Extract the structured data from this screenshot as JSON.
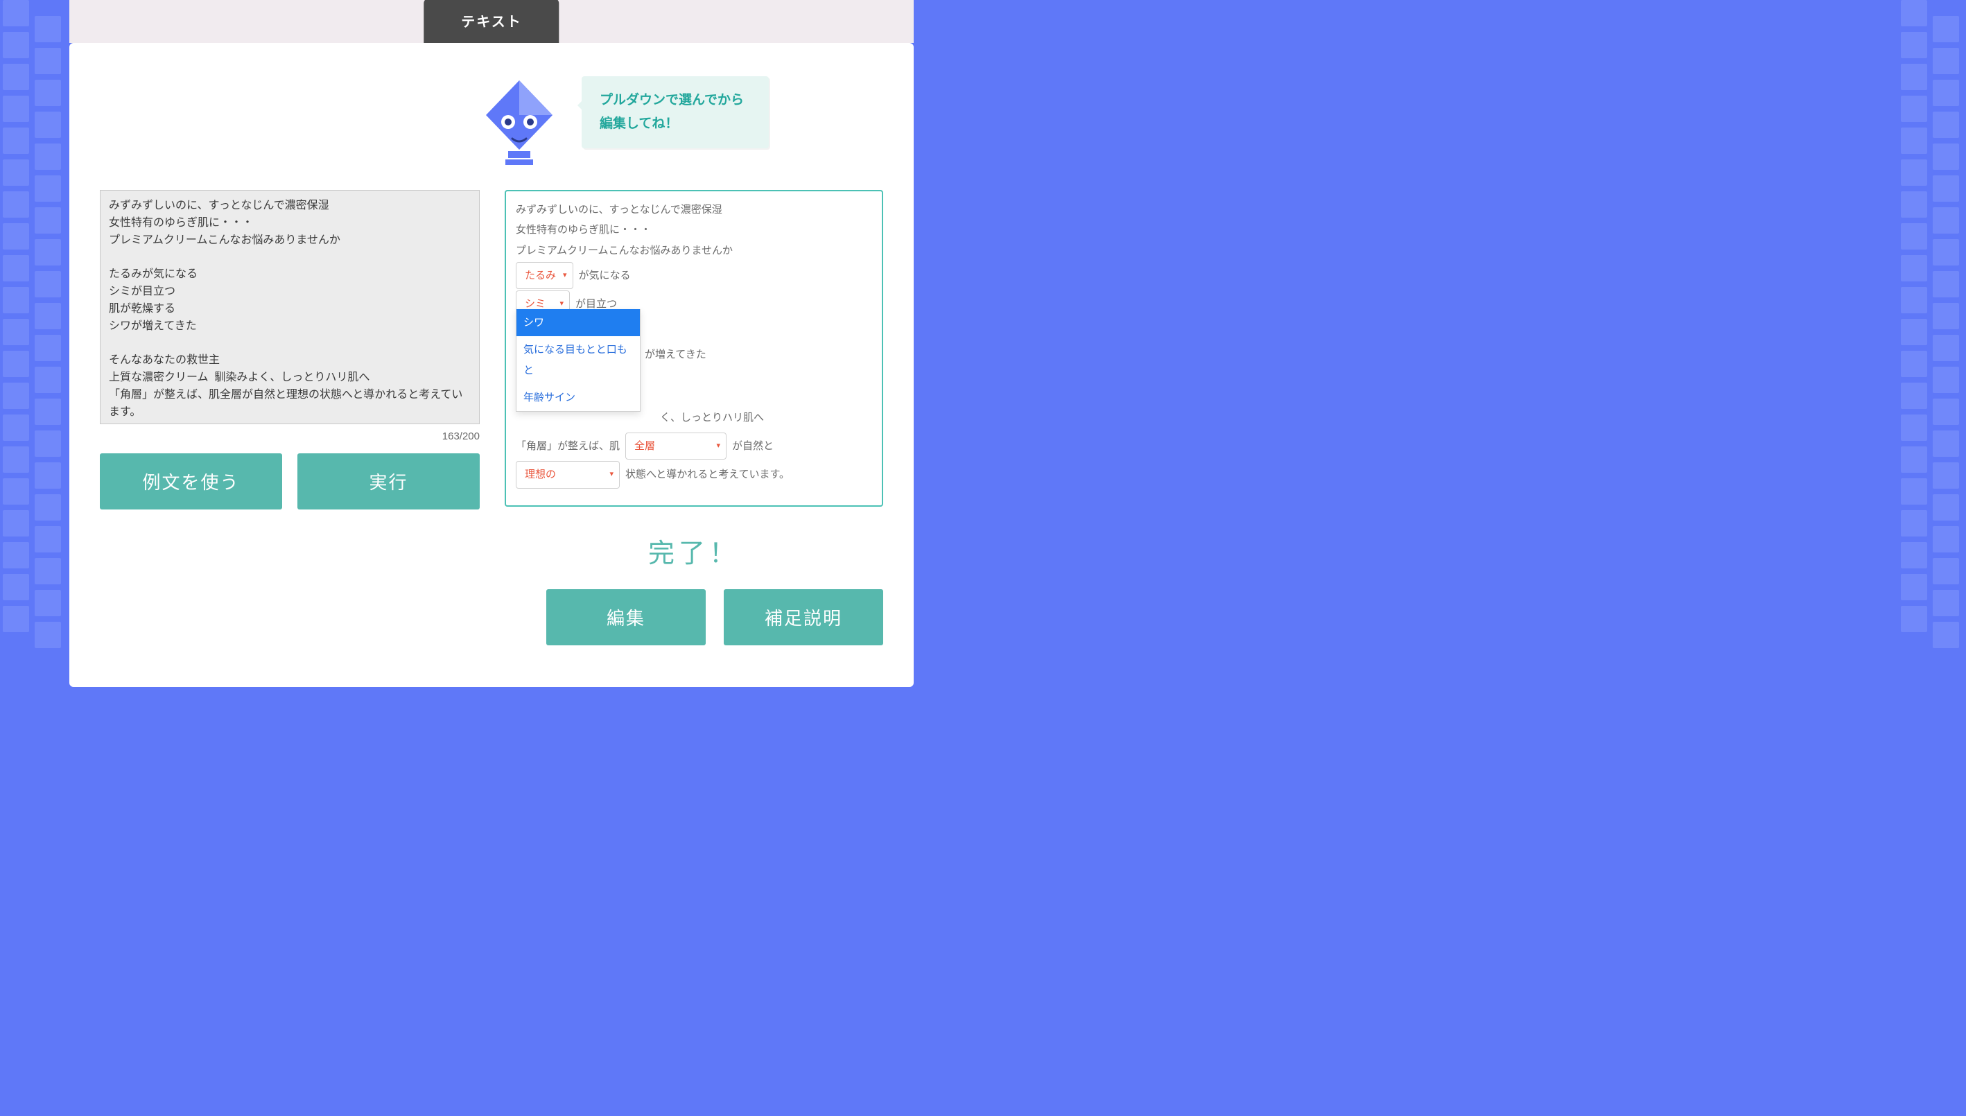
{
  "tab_label": "テキスト",
  "speech_bubble": "プルダウンで選んでから\n編集してね！",
  "textarea_value": "みずみずしいのに、すっとなじんで濃密保湿\n女性特有のゆらぎ肌に・・・\nプレミアムクリームこんなお悩みありませんか\n\nたるみが気になる\nシミが目立つ\n肌が乾燥する\nシワが増えてきた\n\nそんなあなたの救世主\n上質な濃密クリーム  馴染みよく、しっとりハリ肌へ\n「角層」が整えば、肌全層が自然と理想の状態へと導かれると考えています。",
  "char_count": "163/200",
  "buttons": {
    "use_example": "例文を使う",
    "run": "実行",
    "edit": "編集",
    "explain": "補足説明"
  },
  "done_label": "完了！",
  "result": {
    "intro_lines": [
      "みずみずしいのに、すっとなじんで濃密保湿",
      "女性特有のゆらぎ肌に・・・",
      "プレミアムクリームこんなお悩みありませんか"
    ],
    "row1": {
      "select": "たるみ",
      "suffix": "が気になる"
    },
    "row2": {
      "select": "シミ",
      "suffix": "が目立つ"
    },
    "line_dry": "肌が乾燥する",
    "row3": {
      "select": "シワ",
      "suffix": "が増えてきた"
    },
    "dropdown_options": [
      "シワ",
      "気になる目もとと口もと",
      "年齢サイン"
    ],
    "row4_suffix": "く、しっとりハリ肌へ",
    "row5": {
      "prefix": "「角層」が整えば、肌",
      "select": "全層",
      "suffix": "が自然と"
    },
    "row6": {
      "select": "理想の",
      "suffix": "状態へと導かれると考えています。"
    }
  }
}
